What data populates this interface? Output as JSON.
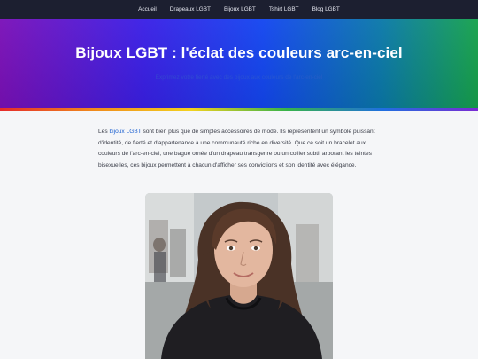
{
  "nav": {
    "items": [
      "Accueil",
      "Drapeaux LGBT",
      "Bijoux LGBT",
      "Tshirt LGBT",
      "Blog LGBT"
    ]
  },
  "hero": {
    "title": "Bijoux LGBT : l'éclat des couleurs arc-en-ciel",
    "subtitle": "Exprimez votre fierté avec des bijoux aux couleurs de l'arc-en-ciel"
  },
  "intro": {
    "before_link": "Les ",
    "link": "bijoux LGBT",
    "after_link": " sont bien plus que de simples accessoires de mode. Ils représentent un symbole puissant d'identité, de fierté et d'appartenance à une communauté riche en diversité. Que ce soit un bracelet aux couleurs de l'arc-en-ciel, une bague ornée d'un drapeau transgenre ou un collier subtil arborant les teintes bisexuelles, ces bijoux permettent à chacun d'afficher ses convictions et son identité avec élégance."
  },
  "colors": {
    "nav_bg": "#1c1f30",
    "gradient": [
      "#7a10b8",
      "#3a1fe6",
      "#1346f0",
      "#0a79a8",
      "#16a24c"
    ],
    "rainbow": [
      "#e52b2b",
      "#f08c1c",
      "#f3d21f",
      "#37b34a",
      "#1f6fe0",
      "#7a2bd3"
    ],
    "link": "#1a5fd0"
  }
}
